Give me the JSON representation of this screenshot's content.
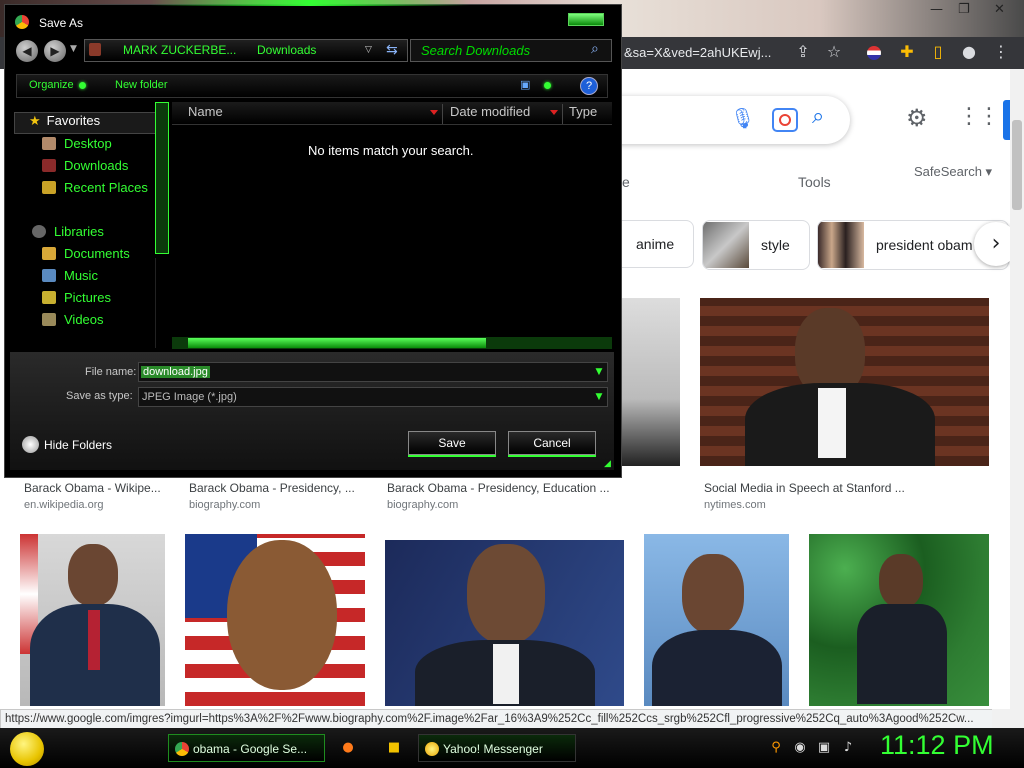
{
  "browser": {
    "window_controls": [
      "—",
      "❐",
      "✕"
    ],
    "url_fragment": "&sa=X&ved=2ahUKEwj...",
    "icons": [
      "share-icon",
      "star-icon",
      "profile-flag-icon",
      "extensions-icon",
      "sidebar-icon",
      "account-icon",
      "menu-icon"
    ]
  },
  "google": {
    "tools_label": "Tools",
    "safesearch_label": "SafeSearch ▾",
    "partial_tab": "e",
    "chips": [
      {
        "label": "anime"
      },
      {
        "label": "style"
      },
      {
        "label": "president obam"
      }
    ],
    "results": [
      {
        "caption": "Barack Obama - Wikipe...",
        "site": "en.wikipedia.org"
      },
      {
        "caption": "Barack Obama - Presidency, ...",
        "site": "biography.com"
      },
      {
        "caption": "Barack Obama - Presidency, Education ...",
        "site": "biography.com"
      },
      {
        "caption": "Social Media in Speech at Stanford ...",
        "site": "nytimes.com"
      }
    ],
    "status_url": "https://www.google.com/imgres?imgurl=https%3A%2F%2Fwww.biography.com%2F.image%2Far_16%3A9%252Cc_fill%252Ccs_srgb%252Cfl_progressive%252Cq_auto%3Agood%252Cw..."
  },
  "dialog": {
    "title": "Save As",
    "breadcrumb": [
      "MARK ZUCKERBE...",
      "Downloads"
    ],
    "search_placeholder": "Search Downloads",
    "organize_label": "Organize",
    "new_folder_label": "New folder",
    "nav": {
      "favorites": "Favorites",
      "desktop": "Desktop",
      "downloads": "Downloads",
      "recent": "Recent Places",
      "libraries": "Libraries",
      "documents": "Documents",
      "music": "Music",
      "pictures": "Pictures",
      "videos": "Videos"
    },
    "columns": [
      "Name",
      "Date modified",
      "Type"
    ],
    "empty_message": "No items match your search.",
    "file_name_label": "File name:",
    "file_name_value": "download.jpg",
    "save_type_label": "Save as type:",
    "save_type_value": "JPEG Image (*.jpg)",
    "hide_folders_label": "Hide Folders",
    "save_label": "Save",
    "cancel_label": "Cancel"
  },
  "taskbar": {
    "tasks": [
      "obama - Google Se...",
      "Yahoo! Messenger"
    ],
    "clock": "11:12 PM"
  }
}
